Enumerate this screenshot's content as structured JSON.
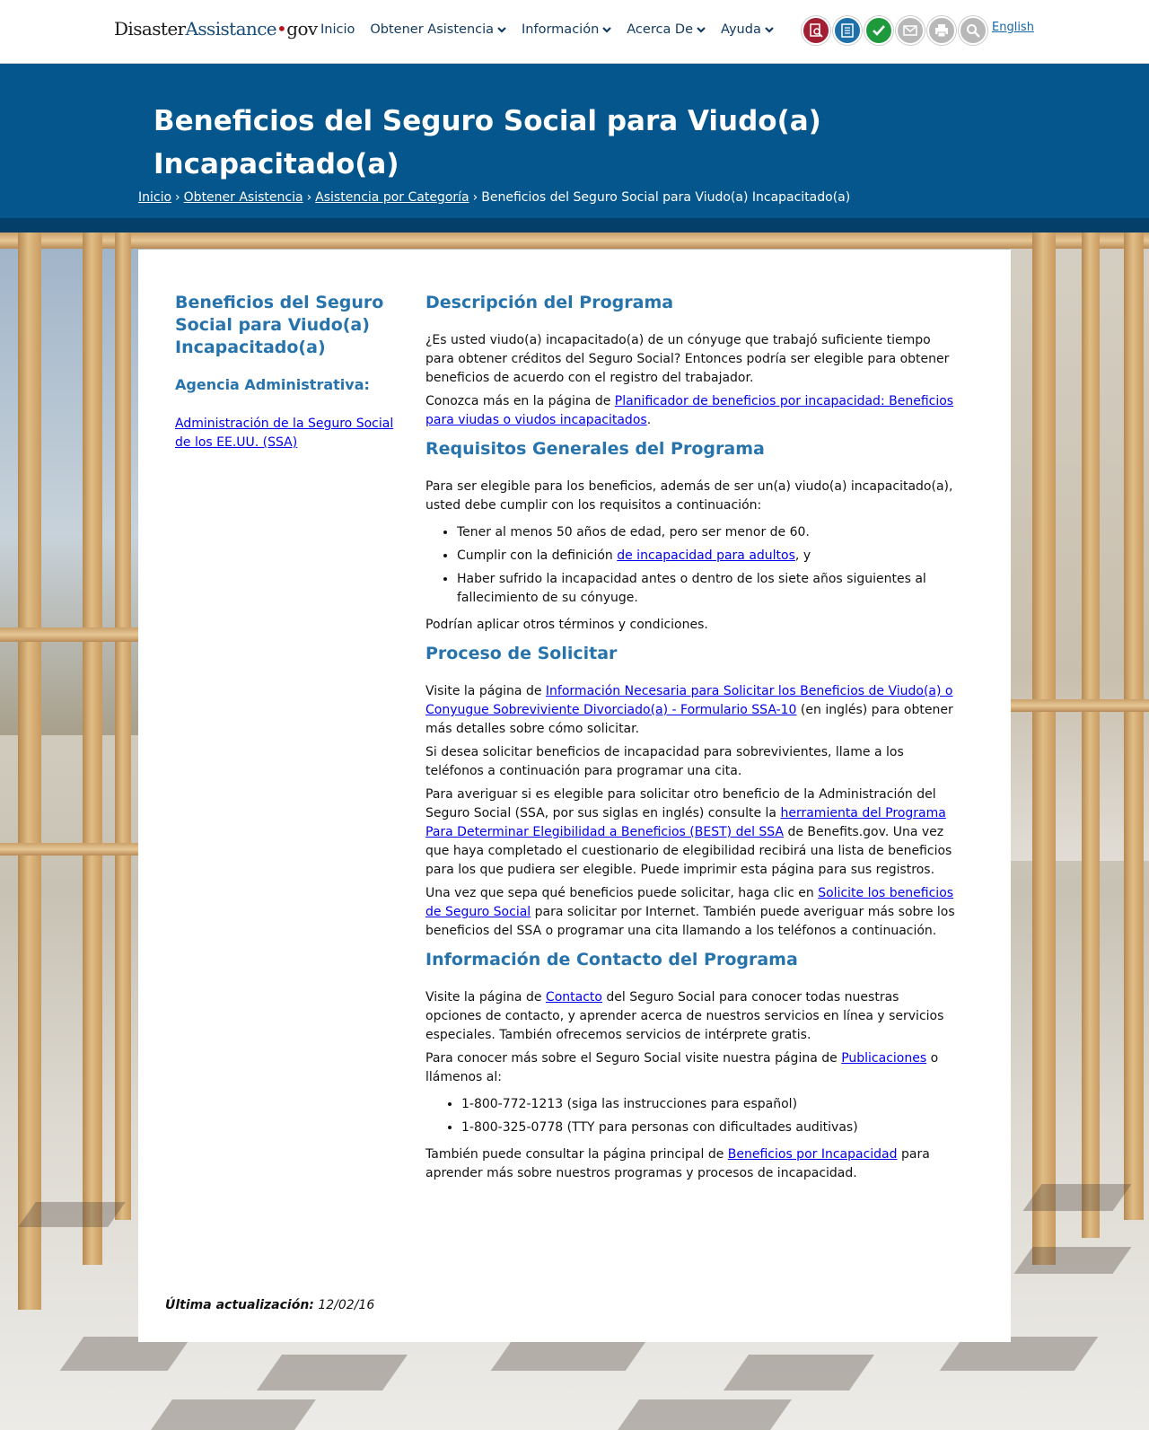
{
  "header": {
    "logo": {
      "part1": "Disaster",
      "part2": "Assistance",
      "part3": "gov"
    },
    "nav": [
      {
        "label": "Inicio",
        "has_dropdown": false
      },
      {
        "label": "Obtener Asistencia",
        "has_dropdown": true
      },
      {
        "label": "Información",
        "has_dropdown": true
      },
      {
        "label": "Acerca De",
        "has_dropdown": true
      },
      {
        "label": "Ayuda",
        "has_dropdown": true
      }
    ],
    "icons": [
      {
        "name": "search-document-icon",
        "color": "#a31f34"
      },
      {
        "name": "checklist-icon",
        "color": "#1f6fa8"
      },
      {
        "name": "check-icon",
        "color": "#1e9a3c"
      },
      {
        "name": "mail-icon",
        "color": "#b8b8b8"
      },
      {
        "name": "print-icon",
        "color": "#b8b8b8"
      },
      {
        "name": "magnifier-icon",
        "color": "#b8b8b8"
      }
    ],
    "language_link": "English"
  },
  "banner": {
    "title": "Beneficios del Seguro Social para Viudo(a) Incapacitado(a)",
    "breadcrumb": [
      "Inicio",
      "Obtener Asistencia",
      "Asistencia por Categoría"
    ],
    "breadcrumb_current": "Beneficios del Seguro Social para Viudo(a) Incapacitado(a)",
    "breadcrumb_separator": "›"
  },
  "sidebar": {
    "title": "Beneficios del Seguro Social para Viudo(a) Incapacitado(a)",
    "agency_label": "Agencia Administrativa:",
    "agency_link": "Administración de la Seguro Social de los EE.UU. (SSA)"
  },
  "content": {
    "desc": {
      "heading": "Descripción del Programa",
      "p1": "¿Es usted viudo(a) incapacitado(a) de un cónyuge que trabajó suficiente tiempo para obtener créditos del Seguro Social? Entonces podría ser elegible para obtener beneficios de acuerdo con el registro del trabajador.",
      "p2_pre": "Conozca más en la página de ",
      "p2_link": "Planificador de beneficios por incapacidad: Beneficios para viudas o viudos incapacitados",
      "p2_post": "."
    },
    "req": {
      "heading": "Requisitos Generales del Programa",
      "p1": "Para ser elegible para los beneficios, además de ser un(a) viudo(a) incapacitado(a), usted debe cumplir con los requisitos a continuación:",
      "li1": "Tener al menos 50 años de edad, pero ser menor de 60.",
      "li2_pre": "Cumplir con la definición ",
      "li2_link": "de incapacidad para adultos",
      "li2_post": ", y",
      "li3": "Haber sufrido la incapacidad antes o dentro de los siete años siguientes al fallecimiento de su cónyuge.",
      "p2": "Podrían aplicar otros términos y condiciones."
    },
    "proc": {
      "heading": "Proceso de Solicitar",
      "p1_pre": "Visite la página de ",
      "p1_link": "Información Necesaria para Solicitar los Beneficios de Viudo(a) o Conyugue Sobreviviente Divorciado(a) - Formulario SSA-10",
      "p1_post": " (en inglés) para obtener más detalles sobre cómo solicitar.",
      "p2": "Si desea solicitar beneficios de incapacidad para sobrevivientes, llame a los teléfonos a continuación para programar una cita.",
      "p3_pre": "Para averiguar si es elegible para solicitar otro beneficio de la Administración del Seguro Social (SSA, por sus siglas en inglés) consulte la ",
      "p3_link": "herramienta del Programa Para Determinar Elegibilidad a Beneficios (BEST) del SSA",
      "p3_post": " de Benefits.gov. Una vez que haya completado el cuestionario de elegibilidad recibirá una lista de beneficios para los que pudiera ser elegible. Puede imprimir esta página para sus registros.",
      "p4_pre": "Una vez que sepa qué beneficios puede solicitar, haga clic en ",
      "p4_link": "Solicite los beneficios de Seguro Social",
      "p4_post": " para solicitar por Internet. También puede averiguar más sobre los beneficios del SSA o programar una cita llamando a los teléfonos a continuación."
    },
    "contact": {
      "heading": "Información de Contacto del Programa",
      "p1_pre": "Visite la página de ",
      "p1_link": "Contacto",
      "p1_post": " del Seguro Social para conocer todas nuestras opciones de contacto, y aprender acerca de nuestros servicios en línea y servicios especiales. También ofrecemos servicios de intérprete gratis.",
      "p2_pre": "Para conocer más sobre el Seguro Social visite nuestra página de ",
      "p2_link": "Publicaciones",
      "p2_post": " o llámenos al:",
      "phone1": "1-800-772-1213 (siga las instrucciones para español)",
      "phone2": "1-800-325-0778 (TTY para personas con dificultades auditivas)",
      "p3_pre": "También puede consultar la página principal de ",
      "p3_link": "Beneficios por Incapacidad",
      "p3_post": " para aprender más sobre nuestros programas y procesos de incapacidad."
    }
  },
  "footer": {
    "updated_label": "Última actualización:",
    "updated_value": "12/02/16"
  }
}
